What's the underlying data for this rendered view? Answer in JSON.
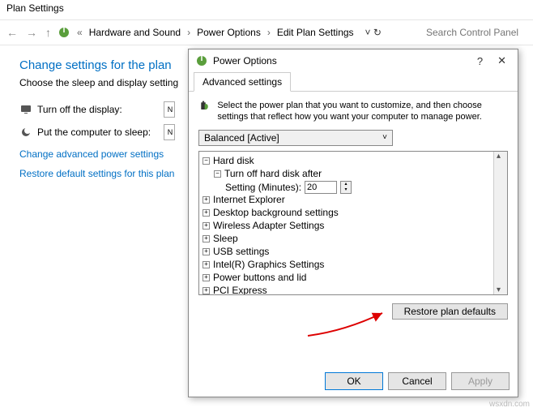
{
  "window": {
    "title": "Plan Settings"
  },
  "nav": {
    "crumb1": "Hardware and Sound",
    "crumb2": "Power Options",
    "crumb3": "Edit Plan Settings",
    "search_placeholder": "Search Control Panel"
  },
  "page": {
    "heading": "Change settings for the plan",
    "subheading": "Choose the sleep and display setting",
    "display_label": "Turn off the display:",
    "sleep_label": "Put the computer to sleep:",
    "dd_value": "N",
    "link_advanced": "Change advanced power settings",
    "link_restore": "Restore default settings for this plan"
  },
  "modal": {
    "title": "Power Options",
    "tab": "Advanced settings",
    "desc": "Select the power plan that you want to customize, and then choose settings that reflect how you want your computer to manage power.",
    "plan": "Balanced [Active]",
    "restore_btn": "Restore plan defaults",
    "ok": "OK",
    "cancel": "Cancel",
    "apply": "Apply",
    "tree": {
      "hard_disk": "Hard disk",
      "turn_off": "Turn off hard disk after",
      "setting_label": "Setting (Minutes):",
      "setting_value": "20",
      "ie": "Internet Explorer",
      "desktop": "Desktop background settings",
      "wifi": "Wireless Adapter Settings",
      "sleep": "Sleep",
      "usb": "USB settings",
      "intel": "Intel(R) Graphics Settings",
      "power_btn": "Power buttons and lid",
      "pci": "PCI Express"
    }
  },
  "watermark": "wsxdn.com"
}
